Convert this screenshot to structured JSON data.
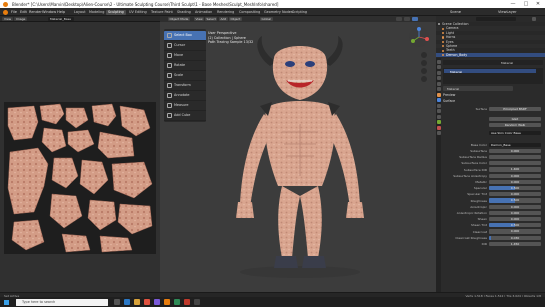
{
  "window": {
    "title": "Blender* [C:\\Users\\Marvin\\Desktop\\Alien-Course\\2 - Ultimate Sculpting Course\\Third Sculpt\\1 - Base Meshes\\Sculpt_MeshInfo\\shared]",
    "controls": [
      "—",
      "□",
      "✕"
    ]
  },
  "menubar": {
    "menus": [
      "File",
      "Edit",
      "Render",
      "Window",
      "Help"
    ],
    "workspaces": [
      "Layout",
      "Modeling",
      "Sculpting",
      "UV Editing",
      "Texture Paint",
      "Shading",
      "Animation",
      "Rendering",
      "Compositing",
      "Geometry Nodes",
      "Scripting"
    ],
    "active_workspace": "Sculpting",
    "scene": "Scene",
    "view_layer": "ViewLayer"
  },
  "uv_editor": {
    "header": [
      "View",
      "Image",
      "Material_Base"
    ]
  },
  "viewport": {
    "header": [
      "Object Mode",
      "View",
      "Select",
      "Add",
      "Object"
    ],
    "shading": "Global",
    "info": [
      "User Perspective",
      "(2) Collection | Sphere",
      "Path Tracing Sample 13/32"
    ],
    "tools": [
      {
        "label": "Select Box",
        "active": true
      },
      {
        "label": "Cursor",
        "active": false
      },
      {
        "label": "Move",
        "active": false
      },
      {
        "label": "Rotate",
        "active": false
      },
      {
        "label": "Scale",
        "active": false
      },
      {
        "label": "Transform",
        "active": false
      },
      {
        "label": "Annotate",
        "active": false
      },
      {
        "label": "Measure",
        "active": false
      },
      {
        "label": "Add Cube",
        "active": false
      }
    ],
    "gizmo_axes": [
      "X",
      "Y",
      "Z"
    ]
  },
  "outliner": {
    "items": [
      {
        "label": "Scene Collection",
        "selected": false,
        "color": "#aaaaaa"
      },
      {
        "label": "Camera",
        "selected": false,
        "color": "#e0914b"
      },
      {
        "label": "Light",
        "selected": false,
        "color": "#e0914b"
      },
      {
        "label": "Horns",
        "selected": false,
        "color": "#e0914b"
      },
      {
        "label": "Eyes",
        "selected": false,
        "color": "#e0914b"
      },
      {
        "label": "Sphere",
        "selected": false,
        "color": "#e0914b"
      },
      {
        "label": "Teeth",
        "selected": false,
        "color": "#e0914b"
      },
      {
        "label": "Demon_Body",
        "selected": true,
        "color": "#e0914b"
      }
    ]
  },
  "properties": {
    "object_name": "",
    "material_slot": "Material",
    "material_name": "Material",
    "sections": [
      "Preview",
      "Surface"
    ],
    "surface_shader": "Principled BSDF",
    "distribution": "GGX",
    "subsurface_method": "Random Walk",
    "base_color_source": "Ase Skin Color Base",
    "rows": [
      {
        "label": "Base Color",
        "value": "Demon_Base",
        "fill": 0.0,
        "kind": "dark"
      },
      {
        "label": "Subsurface",
        "value": "0.000",
        "fill": 0.0,
        "kind": "value"
      },
      {
        "label": "Subsurface Radius",
        "value": "",
        "fill": 0.0,
        "kind": "value"
      },
      {
        "label": "Subsurface Color",
        "value": "",
        "fill": 0.0,
        "kind": "value"
      },
      {
        "label": "Subsurface IOR",
        "value": "1.400",
        "fill": 0.0,
        "kind": "value"
      },
      {
        "label": "Subsurface Anisotropy",
        "value": "0.000",
        "fill": 0.0,
        "kind": "value"
      },
      {
        "label": "Metallic",
        "value": "0.000",
        "fill": 0.0,
        "kind": "value"
      },
      {
        "label": "Specular",
        "value": "0.500",
        "fill": 0.5,
        "kind": "value"
      },
      {
        "label": "Specular Tint",
        "value": "0.000",
        "fill": 0.0,
        "kind": "value"
      },
      {
        "label": "Roughness",
        "value": "0.500",
        "fill": 0.5,
        "kind": "value"
      },
      {
        "label": "Anisotropic",
        "value": "0.000",
        "fill": 0.0,
        "kind": "value"
      },
      {
        "label": "Anisotropic Rotation",
        "value": "0.000",
        "fill": 0.0,
        "kind": "value"
      },
      {
        "label": "Sheen",
        "value": "0.000",
        "fill": 0.0,
        "kind": "value"
      },
      {
        "label": "Sheen Tint",
        "value": "0.500",
        "fill": 0.5,
        "kind": "value"
      },
      {
        "label": "Clearcoat",
        "value": "0.000",
        "fill": 0.0,
        "kind": "value"
      },
      {
        "label": "Clearcoat Roughness",
        "value": "0.030",
        "fill": 0.03,
        "kind": "value"
      },
      {
        "label": "IOR",
        "value": "1.450",
        "fill": 0.0,
        "kind": "value"
      }
    ]
  },
  "statusbar": {
    "left": "Set Active",
    "right": "Verts 1,518 | Faces 1,512 | Tris 3,024 | Objects 1/8"
  },
  "taskbar": {
    "search_placeholder": "Type here to search",
    "time": "",
    "date": ""
  },
  "colors": {
    "accent": "#4772b3",
    "skin": "#d8a68e",
    "texture_bg": "#1e1e1e",
    "viewport_bg": "#3c3c3c"
  }
}
